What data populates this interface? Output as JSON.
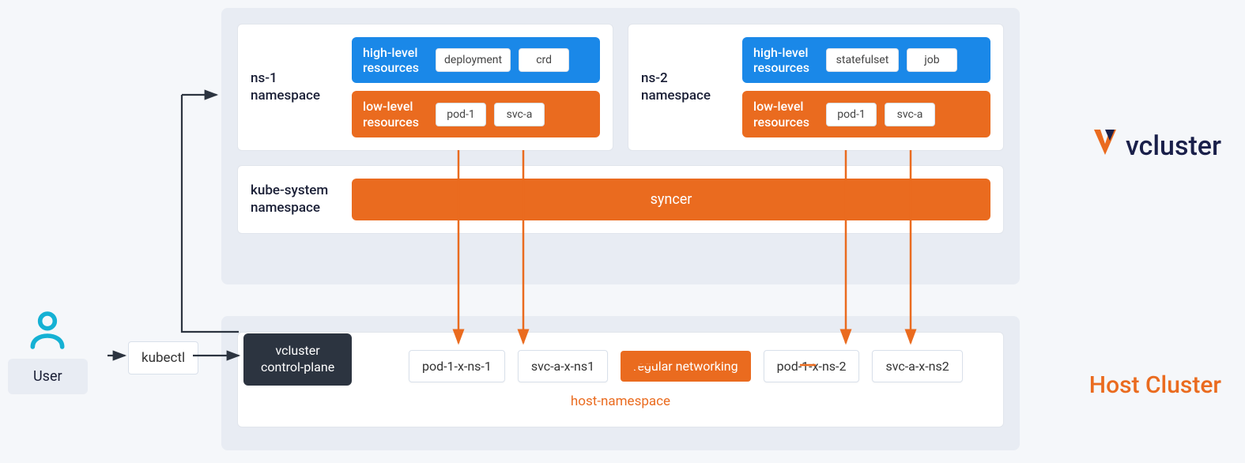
{
  "user": {
    "label": "User"
  },
  "kubectl": {
    "label": "kubectl"
  },
  "control_plane": {
    "line1": "vcluster",
    "line2": "control-plane"
  },
  "vcluster": {
    "brand": "vcluster",
    "ns1": {
      "label_a": "ns-1",
      "label_b": "namespace",
      "high_label_a": "high-level",
      "high_label_b": "resources",
      "high_items": [
        "deployment",
        "crd"
      ],
      "low_label_a": "low-level",
      "low_label_b": "resources",
      "low_items": [
        "pod-1",
        "svc-a"
      ]
    },
    "ns2": {
      "label_a": "ns-2",
      "label_b": "namespace",
      "high_label_a": "high-level",
      "high_label_b": "resources",
      "high_items": [
        "statefulset",
        "job"
      ],
      "low_label_a": "low-level",
      "low_label_b": "resources",
      "low_items": [
        "pod-1",
        "svc-a"
      ]
    },
    "kube_system": {
      "label_a": "kube-system",
      "label_b": "namespace"
    },
    "syncer": "syncer"
  },
  "host": {
    "label": "Host Cluster",
    "namespace_label": "host-namespace",
    "pods": {
      "p1": "pod-1-x-ns-1",
      "s1": "svc-a-x-ns1",
      "net": "regular networking",
      "p2": "pod-1-x-ns-2",
      "s2": "svc-a-x-ns2"
    }
  },
  "colors": {
    "blue": "#1a88e8",
    "orange": "#ea6b1f",
    "dark": "#2c3440",
    "cyan": "#15b1d4"
  }
}
